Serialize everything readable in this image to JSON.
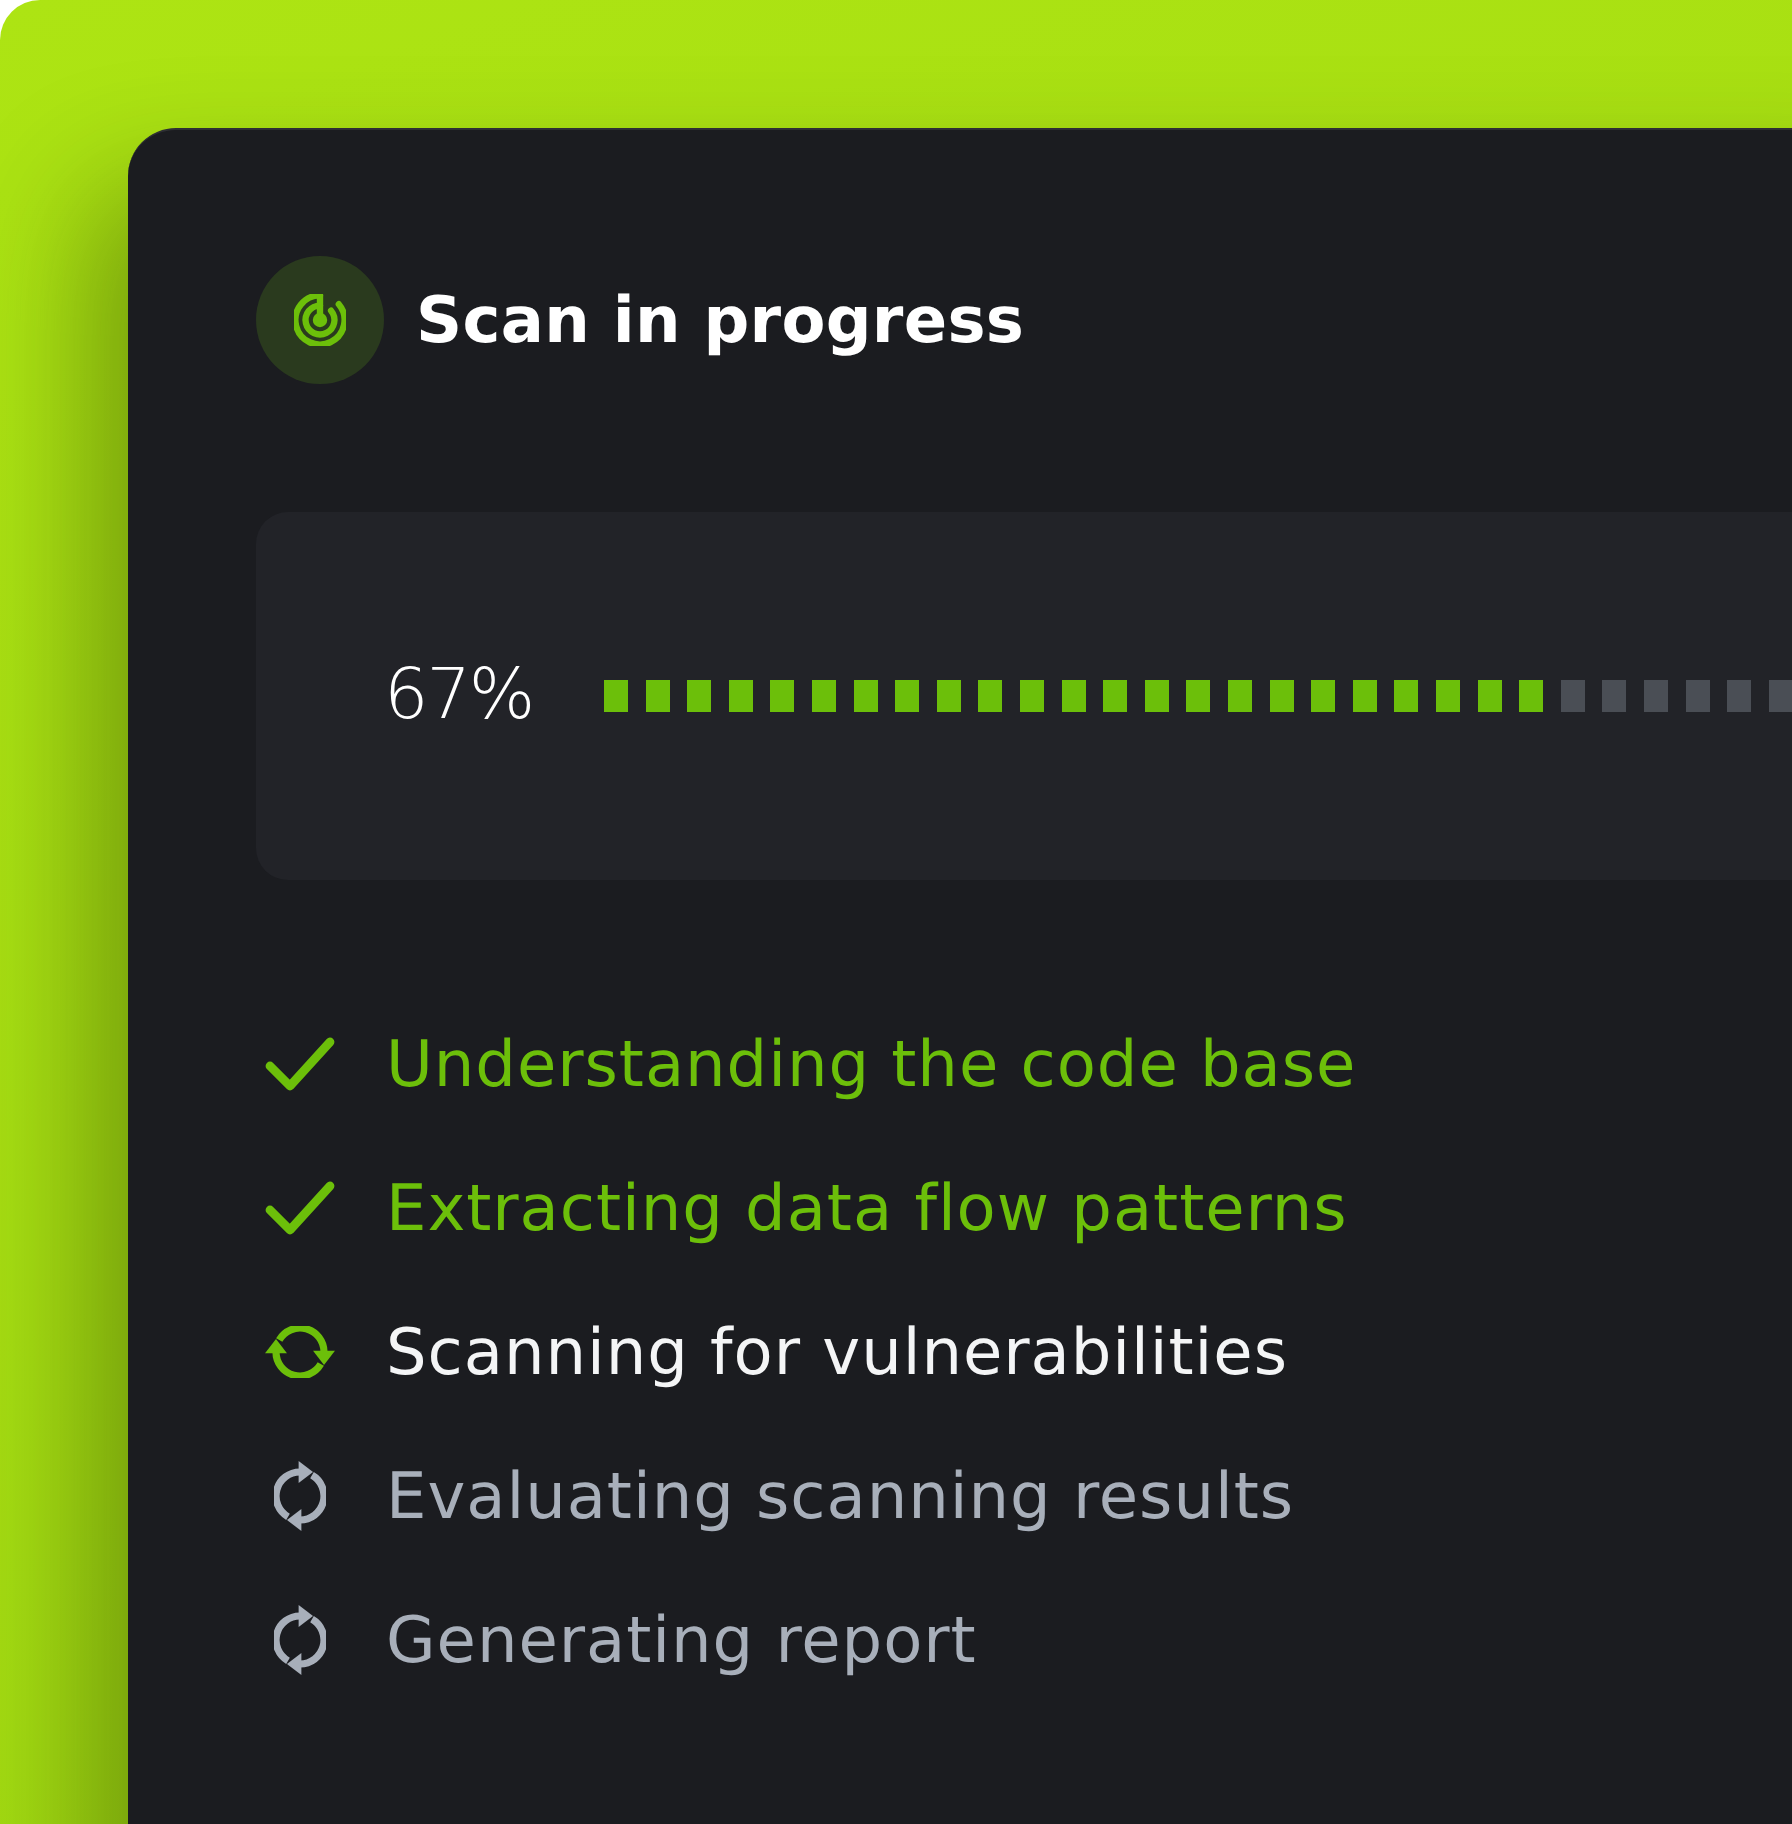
{
  "header": {
    "title": "Scan in progress"
  },
  "progress": {
    "reading": "67%",
    "level": 0.67
  },
  "steps": [
    {
      "label": "Understanding the code base",
      "kind": "done"
    },
    {
      "label": "Extracting data flow patterns",
      "kind": "done"
    },
    {
      "label": "Scanning for vulnerabilities",
      "kind": "active"
    },
    {
      "label": "Evaluating scanning results",
      "kind": "pending"
    },
    {
      "label": "Generating report",
      "kind": "pending"
    }
  ]
}
